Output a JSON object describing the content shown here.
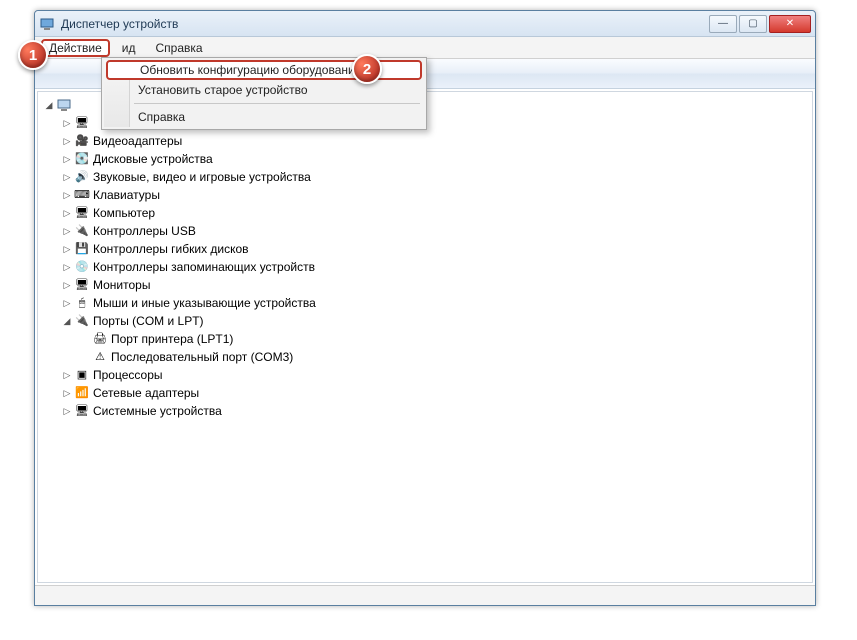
{
  "window": {
    "title": "Диспетчер устройств"
  },
  "menubar": {
    "file_hidden": "",
    "action": "Действие",
    "i_d": "ид",
    "help": "Справка"
  },
  "dropdown": {
    "scan": "Обновить конфигурацию оборудования",
    "legacy": "Установить старое устройство",
    "help": "Справка"
  },
  "root": "",
  "tree": [
    {
      "level": 1,
      "twisty": "▷",
      "icon": "🖥",
      "label": ""
    },
    {
      "level": 1,
      "twisty": "▷",
      "icon": "🎥",
      "label": "Видеоадаптеры"
    },
    {
      "level": 1,
      "twisty": "▷",
      "icon": "💽",
      "label": "Дисковые устройства"
    },
    {
      "level": 1,
      "twisty": "▷",
      "icon": "🔊",
      "label": "Звуковые, видео и игровые устройства"
    },
    {
      "level": 1,
      "twisty": "▷",
      "icon": "⌨",
      "label": "Клавиатуры"
    },
    {
      "level": 1,
      "twisty": "▷",
      "icon": "🖥",
      "label": "Компьютер"
    },
    {
      "level": 1,
      "twisty": "▷",
      "icon": "🔌",
      "label": "Контроллеры USB"
    },
    {
      "level": 1,
      "twisty": "▷",
      "icon": "💾",
      "label": "Контроллеры гибких дисков"
    },
    {
      "level": 1,
      "twisty": "▷",
      "icon": "💿",
      "label": "Контроллеры запоминающих устройств"
    },
    {
      "level": 1,
      "twisty": "▷",
      "icon": "🖥",
      "label": "Мониторы"
    },
    {
      "level": 1,
      "twisty": "▷",
      "icon": "🖱",
      "label": "Мыши и иные указывающие устройства"
    },
    {
      "level": 1,
      "twisty": "◢",
      "icon": "🔌",
      "label": "Порты (COM и LPT)"
    },
    {
      "level": 2,
      "twisty": "",
      "icon": "🖨",
      "label": "Порт принтера (LPT1)"
    },
    {
      "level": 2,
      "twisty": "",
      "icon": "⚠",
      "label": "Последовательный порт (COM3)"
    },
    {
      "level": 1,
      "twisty": "▷",
      "icon": "▣",
      "label": "Процессоры"
    },
    {
      "level": 1,
      "twisty": "▷",
      "icon": "📶",
      "label": "Сетевые адаптеры"
    },
    {
      "level": 1,
      "twisty": "▷",
      "icon": "🖥",
      "label": "Системные устройства"
    }
  ],
  "badges": {
    "one": "1",
    "two": "2"
  }
}
